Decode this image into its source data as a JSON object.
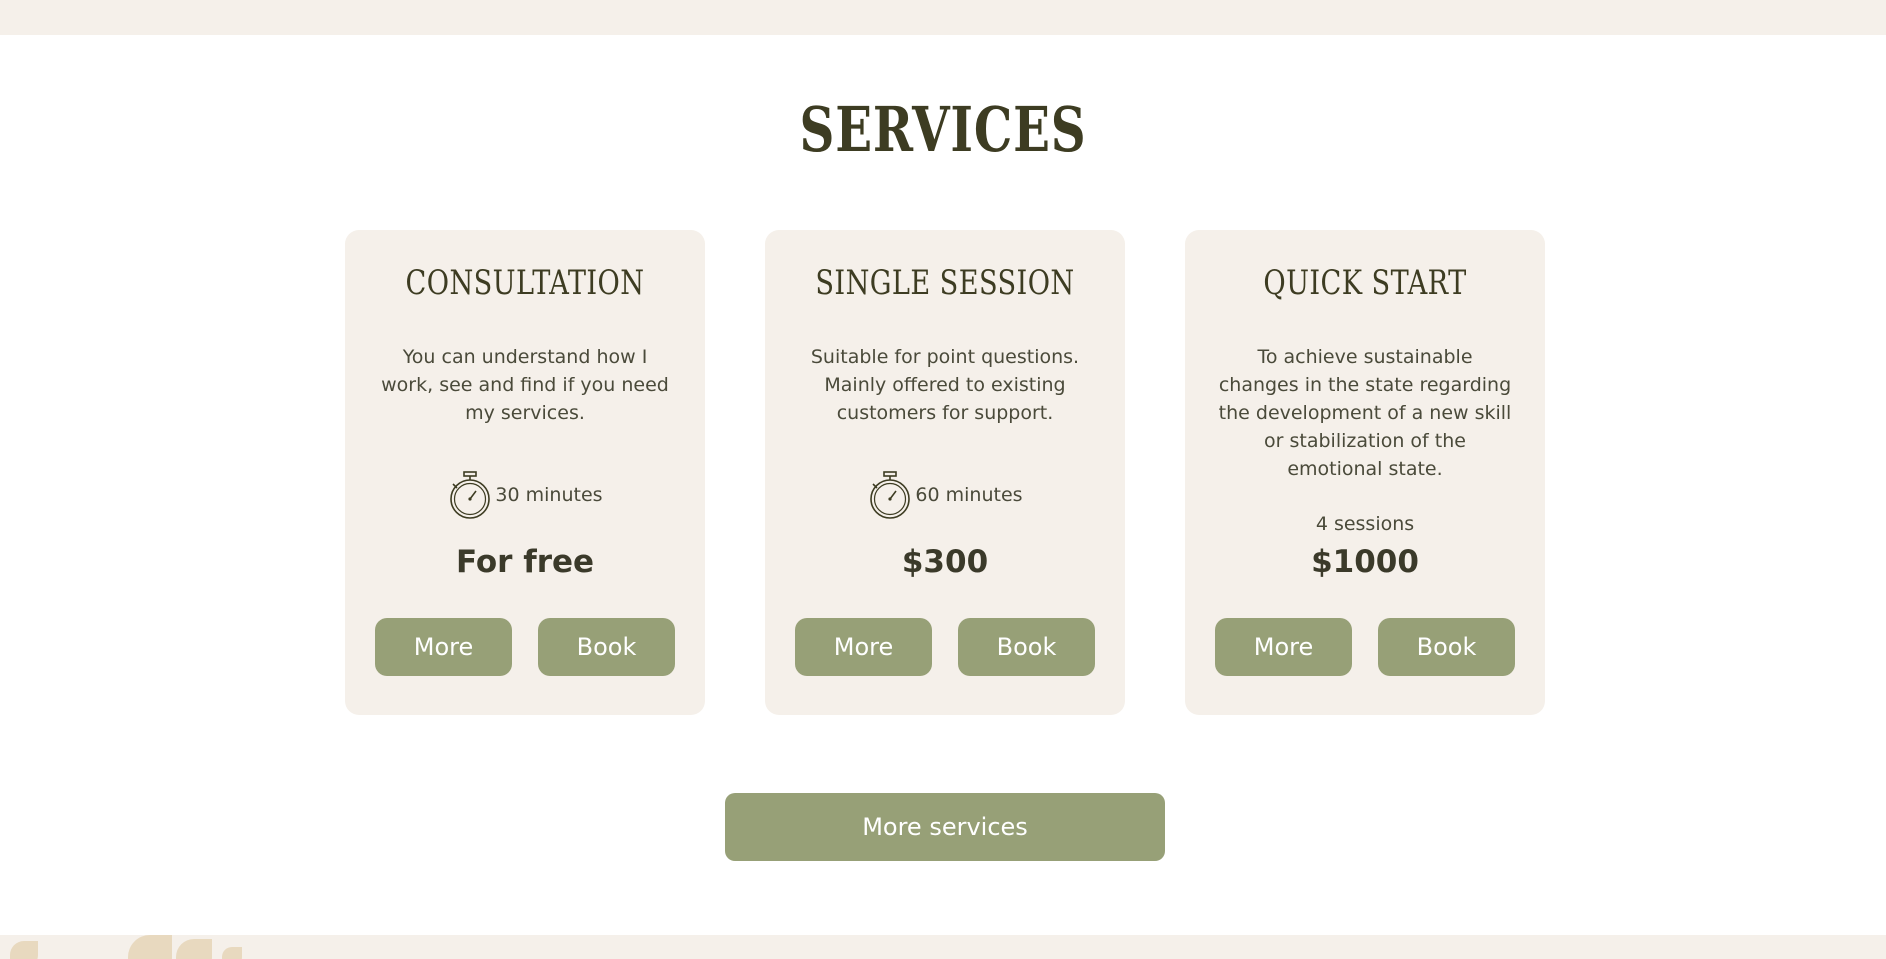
{
  "section": {
    "title": "SERVICES"
  },
  "cards": [
    {
      "title": "CONSULTATION",
      "description": "You can understand how I work, see and find if you need my services.",
      "duration": "30 minutes",
      "price": "For free",
      "more_label": "More",
      "book_label": "Book"
    },
    {
      "title": "SINGLE SESSION",
      "description": "Suitable for point questions. Mainly offered to existing customers for support.",
      "duration": "60 minutes",
      "price": "$300",
      "more_label": "More",
      "book_label": "Book"
    },
    {
      "title": "QUICK START",
      "description": "To achieve sustainable changes in the state regarding the development of a new skill or stabilization of the emotional state.",
      "sessions": "4 sessions",
      "price": "$1000",
      "more_label": "More",
      "book_label": "Book"
    }
  ],
  "more_services_label": "More services",
  "icons": {
    "duration": "stopwatch-icon"
  },
  "colors": {
    "accent": "#97a077",
    "card_background": "#f5f0ea",
    "heading": "#3d3c22",
    "text": "#4a4a3a",
    "decor_leaf": "#e8d9bf"
  }
}
